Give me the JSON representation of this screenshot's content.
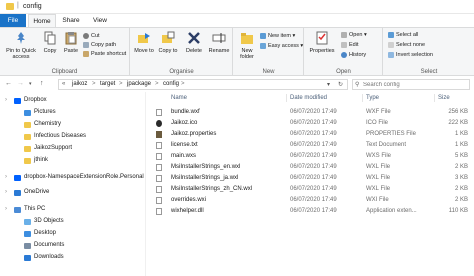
{
  "window": {
    "title": "config",
    "title_separator": "|"
  },
  "tabs": {
    "file": "File",
    "home": "Home",
    "share": "Share",
    "view": "View"
  },
  "ribbon": {
    "clipboard": {
      "label": "Clipboard",
      "pin": "Pin to Quick access",
      "copy": "Copy",
      "paste": "Paste",
      "cut": "Cut",
      "copy_path": "Copy path",
      "paste_shortcut": "Paste shortcut"
    },
    "organise": {
      "label": "Organise",
      "move_to": "Move to",
      "copy_to": "Copy to",
      "delete": "Delete",
      "rename": "Rename"
    },
    "new": {
      "label": "New",
      "new_folder": "New folder",
      "new_item": "New item",
      "easy_access": "Easy access"
    },
    "open": {
      "label": "Open",
      "properties": "Properties",
      "open": "Open",
      "edit": "Edit",
      "history": "History"
    },
    "select": {
      "label": "Select",
      "select_all": "Select all",
      "select_none": "Select none",
      "invert_selection": "Invert selection"
    }
  },
  "address": {
    "back": "←",
    "forward": "→",
    "up": "↑",
    "crumbs": [
      "«",
      "jaikoz",
      "target",
      "jpackage",
      "config"
    ],
    "separator": ">",
    "search_placeholder": "Search config"
  },
  "navpane": {
    "items": [
      {
        "label": "Dropbox",
        "color": "#0061fe"
      },
      {
        "label": "Pictures",
        "color": "#3d8ee0"
      },
      {
        "label": "Chemistry",
        "color": "#f0c84a"
      },
      {
        "label": "Infectious Diseases",
        "color": "#f0c84a"
      },
      {
        "label": "JaikozSupport",
        "color": "#f0c84a"
      },
      {
        "label": "jthink",
        "color": "#f0c84a"
      },
      {
        "label": "dropbox-NamespaceExtensionRole.Personal",
        "color": "#0061fe"
      },
      {
        "label": "OneDrive",
        "color": "#2a7ad5"
      },
      {
        "label": "This PC",
        "color": "#4b8bd6"
      },
      {
        "label": "3D Objects",
        "color": "#6ab0e8"
      },
      {
        "label": "Desktop",
        "color": "#3d8ee0"
      },
      {
        "label": "Documents",
        "color": "#7a8da3"
      },
      {
        "label": "Downloads",
        "color": "#2a7ad5"
      }
    ]
  },
  "filelist": {
    "columns": {
      "name": "Name",
      "date": "Date modified",
      "type": "Type",
      "size": "Size"
    },
    "rows": [
      {
        "name": "bundle.wxf",
        "date": "06/07/2020 17:49",
        "type": "WXF File",
        "size": "256 KB",
        "icon": "file-icon",
        "color": "#ffffff"
      },
      {
        "name": "Jaikoz.ico",
        "date": "06/07/2020 17:49",
        "type": "ICO File",
        "size": "222 KB",
        "icon": "jaikoz-icon",
        "color": "#2b2b2b"
      },
      {
        "name": "Jaikoz.properties",
        "date": "06/07/2020 17:49",
        "type": "PROPERTIES File",
        "size": "1 KB",
        "icon": "properties-icon",
        "color": "#6b5b3e"
      },
      {
        "name": "license.txt",
        "date": "06/07/2020 17:49",
        "type": "Text Document",
        "size": "1 KB",
        "icon": "text-file-icon",
        "color": "#ffffff"
      },
      {
        "name": "main.wxs",
        "date": "06/07/2020 17:49",
        "type": "WXS File",
        "size": "5 KB",
        "icon": "file-icon",
        "color": "#ffffff"
      },
      {
        "name": "MsiInstallerStrings_en.wxl",
        "date": "06/07/2020 17:49",
        "type": "WXL File",
        "size": "2 KB",
        "icon": "file-icon",
        "color": "#ffffff"
      },
      {
        "name": "MsiInstallerStrings_ja.wxl",
        "date": "06/07/2020 17:49",
        "type": "WXL File",
        "size": "3 KB",
        "icon": "file-icon",
        "color": "#ffffff"
      },
      {
        "name": "MsiInstallerStrings_zh_CN.wxl",
        "date": "06/07/2020 17:49",
        "type": "WXL File",
        "size": "2 KB",
        "icon": "file-icon",
        "color": "#ffffff"
      },
      {
        "name": "overrides.wxi",
        "date": "06/07/2020 17:49",
        "type": "WXI File",
        "size": "2 KB",
        "icon": "file-icon",
        "color": "#ffffff"
      },
      {
        "name": "wixhelper.dll",
        "date": "06/07/2020 17:49",
        "type": "Application exten...",
        "size": "110 KB",
        "icon": "dll-icon",
        "color": "#ffffff"
      }
    ]
  }
}
